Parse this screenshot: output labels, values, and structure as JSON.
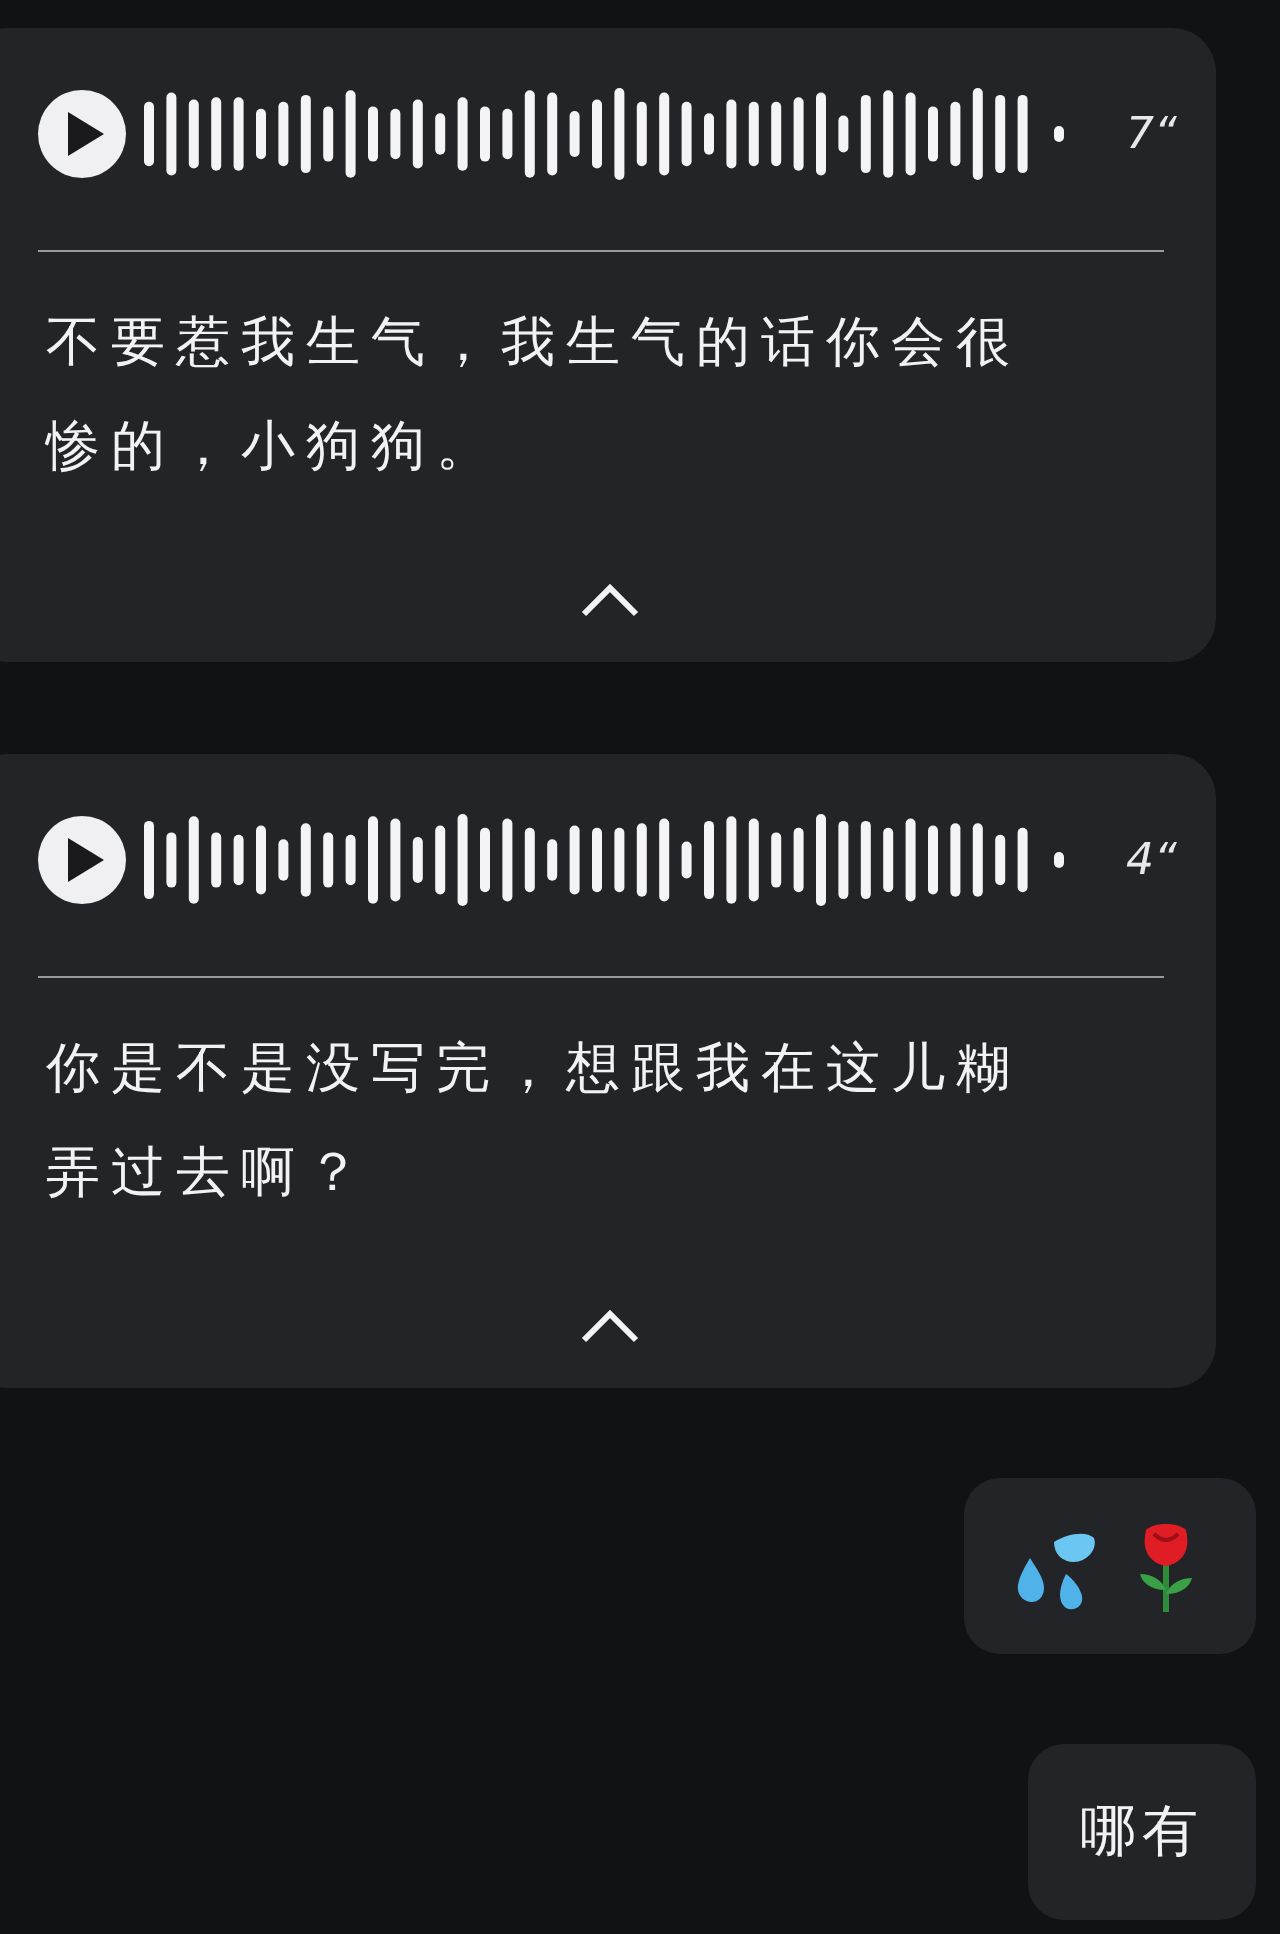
{
  "messages": [
    {
      "kind": "voice",
      "duration": "7“",
      "transcript_lines": [
        "不要惹我生气，我生气的话你会很",
        "惨的，小狗狗。"
      ],
      "expanded": true
    },
    {
      "kind": "voice",
      "duration": "4“",
      "transcript_lines": [
        "你是不是没写完，想跟我在这儿糊",
        "弄过去啊？"
      ],
      "expanded": true
    },
    {
      "kind": "stickers"
    },
    {
      "kind": "text",
      "text": "哪有"
    }
  ]
}
